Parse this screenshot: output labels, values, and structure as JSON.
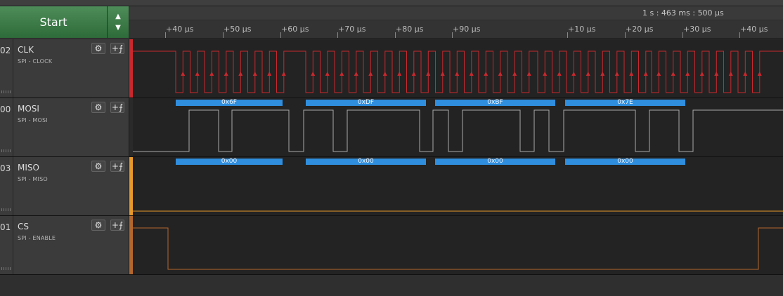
{
  "toolbar": {
    "start_label": "Start",
    "up_arrow": "▲",
    "down_arrow": "▼"
  },
  "timeline": {
    "absolute_time": "1 s : 463 ms : 500 µs",
    "ticks": [
      "+40 µs",
      "+50 µs",
      "+60 µs",
      "+70 µs",
      "+80 µs",
      "+90 µs",
      "+10 µs",
      "+20 µs",
      "+30 µs",
      "+40 µs"
    ]
  },
  "colors": {
    "clk": "#c8282e",
    "mosi": "#a8a8a8",
    "miso": "#e8992a",
    "cs": "#b4672d",
    "protocol_bar": "#2f8ede"
  },
  "channels": [
    {
      "number": "02",
      "name": "CLK",
      "role": "SPI - CLOCK",
      "settings_icon": "gear-icon",
      "trigger_icon": "trigger-icon",
      "button_glyph": "+⨍"
    },
    {
      "number": "00",
      "name": "MOSI",
      "role": "SPI - MOSI",
      "settings_icon": "gear-icon",
      "trigger_icon": "trigger-icon",
      "button_glyph": "+⨍"
    },
    {
      "number": "03",
      "name": "MISO",
      "role": "SPI - MISO",
      "settings_icon": "gear-icon",
      "trigger_icon": "trigger-icon",
      "button_glyph": "+⨍"
    },
    {
      "number": "01",
      "name": "CS",
      "role": "SPI - ENABLE",
      "settings_icon": "gear-icon",
      "trigger_icon": "trigger-icon",
      "button_glyph": "+⨍"
    }
  ],
  "decoded": {
    "mosi": [
      "0x6F",
      "0xDF",
      "0xBF",
      "0x7E"
    ],
    "miso": [
      "0x00",
      "0x00",
      "0x00",
      "0x00"
    ]
  }
}
